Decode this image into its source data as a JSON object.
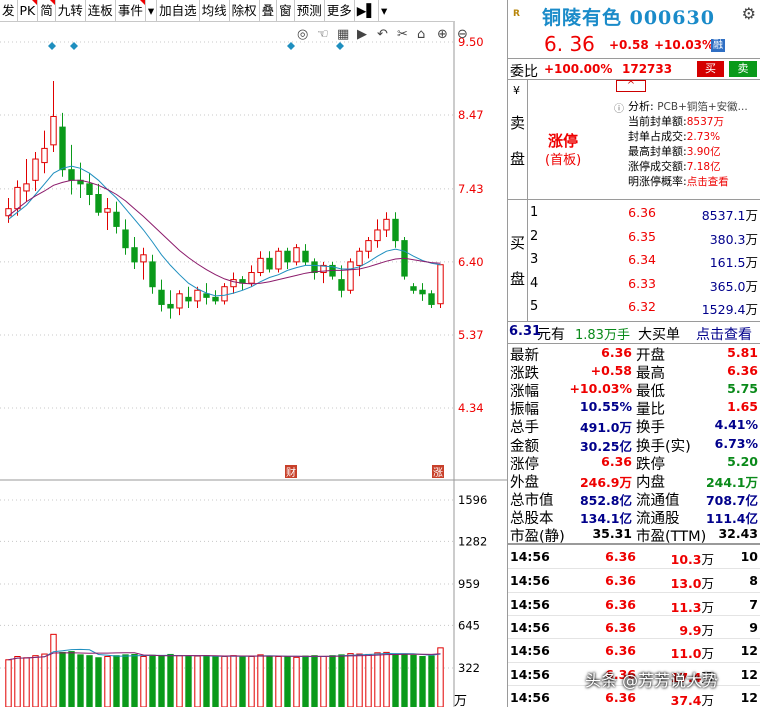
{
  "toolbar": {
    "items": [
      {
        "label": "发",
        "flag": false
      },
      {
        "label": "PK",
        "flag": true
      },
      {
        "label": "简",
        "flag": true
      },
      {
        "label": "九转",
        "flag": false
      },
      {
        "label": "连板",
        "flag": false
      },
      {
        "label": "事件",
        "flag": true
      },
      {
        "label": "▾",
        "flag": false
      },
      {
        "label": "加自选",
        "flag": false
      },
      {
        "label": "均线",
        "flag": false
      },
      {
        "label": "除权",
        "flag": false
      },
      {
        "label": "叠",
        "flag": false
      },
      {
        "label": "窗",
        "flag": false
      },
      {
        "label": "预测",
        "flag": false
      },
      {
        "label": "更多",
        "flag": false
      },
      {
        "label": "▶▌",
        "flag": false
      },
      {
        "label": "▾",
        "flag": false
      }
    ],
    "chart_tools": [
      "◎",
      "☜",
      "▦",
      "▶",
      "↶",
      "✂",
      "⌂",
      "⊕",
      "⊖"
    ]
  },
  "chart_data": {
    "type": "candlestick",
    "price_axis_labels": [
      "9.50",
      "8.47",
      "7.43",
      "6.40",
      "5.37",
      "4.34"
    ],
    "price_ylim": [
      3.4,
      9.5
    ],
    "volume_axis_labels": [
      "1596",
      "1282",
      "959",
      "645",
      "322"
    ],
    "volume_unit": "万",
    "volume_ylim": [
      0,
      1900
    ],
    "event_markers": [
      "财",
      "涨"
    ],
    "colors": {
      "up": "#e00000",
      "down": "#0a9a1a",
      "ma_short": "#1f8fbf",
      "ma_long": "#8b1a6b"
    },
    "candles": [
      {
        "o": 7.05,
        "h": 7.3,
        "l": 6.95,
        "c": 7.15
      },
      {
        "o": 7.15,
        "h": 7.55,
        "l": 7.05,
        "c": 7.45
      },
      {
        "o": 7.4,
        "h": 7.85,
        "l": 7.25,
        "c": 7.5
      },
      {
        "o": 7.55,
        "h": 7.95,
        "l": 7.4,
        "c": 7.85
      },
      {
        "o": 7.8,
        "h": 8.25,
        "l": 7.65,
        "c": 8.0
      },
      {
        "o": 8.05,
        "h": 8.95,
        "l": 7.95,
        "c": 8.45
      },
      {
        "o": 8.3,
        "h": 8.5,
        "l": 7.6,
        "c": 7.7
      },
      {
        "o": 7.7,
        "h": 8.05,
        "l": 7.35,
        "c": 7.55
      },
      {
        "o": 7.55,
        "h": 7.8,
        "l": 7.3,
        "c": 7.5
      },
      {
        "o": 7.5,
        "h": 7.65,
        "l": 7.2,
        "c": 7.35
      },
      {
        "o": 7.35,
        "h": 7.5,
        "l": 7.05,
        "c": 7.1
      },
      {
        "o": 7.1,
        "h": 7.3,
        "l": 6.85,
        "c": 7.15
      },
      {
        "o": 7.1,
        "h": 7.25,
        "l": 6.8,
        "c": 6.9
      },
      {
        "o": 6.85,
        "h": 7.0,
        "l": 6.5,
        "c": 6.6
      },
      {
        "o": 6.6,
        "h": 6.75,
        "l": 6.3,
        "c": 6.4
      },
      {
        "o": 6.4,
        "h": 6.6,
        "l": 6.15,
        "c": 6.5
      },
      {
        "o": 6.4,
        "h": 6.5,
        "l": 5.95,
        "c": 6.05
      },
      {
        "o": 6.0,
        "h": 6.15,
        "l": 5.7,
        "c": 5.8
      },
      {
        "o": 5.8,
        "h": 6.0,
        "l": 5.6,
        "c": 5.75
      },
      {
        "o": 5.75,
        "h": 6.0,
        "l": 5.65,
        "c": 5.95
      },
      {
        "o": 5.9,
        "h": 6.05,
        "l": 5.75,
        "c": 5.85
      },
      {
        "o": 5.85,
        "h": 6.05,
        "l": 5.75,
        "c": 6.0
      },
      {
        "o": 5.95,
        "h": 6.1,
        "l": 5.8,
        "c": 5.9
      },
      {
        "o": 5.9,
        "h": 6.0,
        "l": 5.8,
        "c": 5.85
      },
      {
        "o": 5.85,
        "h": 6.1,
        "l": 5.8,
        "c": 6.05
      },
      {
        "o": 6.05,
        "h": 6.25,
        "l": 5.95,
        "c": 6.15
      },
      {
        "o": 6.15,
        "h": 6.2,
        "l": 6.0,
        "c": 6.1
      },
      {
        "o": 6.1,
        "h": 6.35,
        "l": 6.05,
        "c": 6.25
      },
      {
        "o": 6.25,
        "h": 6.55,
        "l": 6.2,
        "c": 6.45
      },
      {
        "o": 6.45,
        "h": 6.55,
        "l": 6.25,
        "c": 6.3
      },
      {
        "o": 6.3,
        "h": 6.6,
        "l": 6.25,
        "c": 6.55
      },
      {
        "o": 6.55,
        "h": 6.6,
        "l": 6.3,
        "c": 6.4
      },
      {
        "o": 6.4,
        "h": 6.65,
        "l": 6.35,
        "c": 6.6
      },
      {
        "o": 6.55,
        "h": 6.65,
        "l": 6.35,
        "c": 6.4
      },
      {
        "o": 6.4,
        "h": 6.45,
        "l": 6.15,
        "c": 6.25
      },
      {
        "o": 6.25,
        "h": 6.4,
        "l": 6.1,
        "c": 6.35
      },
      {
        "o": 6.35,
        "h": 6.4,
        "l": 6.15,
        "c": 6.2
      },
      {
        "o": 6.15,
        "h": 6.35,
        "l": 5.9,
        "c": 6.0
      },
      {
        "o": 6.0,
        "h": 6.45,
        "l": 5.95,
        "c": 6.4
      },
      {
        "o": 6.35,
        "h": 6.6,
        "l": 6.2,
        "c": 6.55
      },
      {
        "o": 6.55,
        "h": 6.75,
        "l": 6.45,
        "c": 6.7
      },
      {
        "o": 6.7,
        "h": 7.0,
        "l": 6.6,
        "c": 6.85
      },
      {
        "o": 6.85,
        "h": 7.1,
        "l": 6.75,
        "c": 7.0
      },
      {
        "o": 7.0,
        "h": 7.1,
        "l": 6.6,
        "c": 6.7
      },
      {
        "o": 6.7,
        "h": 6.75,
        "l": 6.15,
        "c": 6.2
      },
      {
        "o": 6.05,
        "h": 6.1,
        "l": 5.95,
        "c": 6.0
      },
      {
        "o": 6.0,
        "h": 6.1,
        "l": 5.85,
        "c": 5.95
      },
      {
        "o": 5.95,
        "h": 6.0,
        "l": 5.75,
        "c": 5.8
      },
      {
        "o": 5.81,
        "h": 6.36,
        "l": 5.75,
        "c": 6.36
      }
    ],
    "volumes": [
      200,
      280,
      250,
      300,
      340,
      820,
      380,
      400,
      320,
      300,
      250,
      280,
      300,
      320,
      330,
      280,
      310,
      290,
      330,
      300,
      280,
      290,
      300,
      270,
      280,
      300,
      290,
      280,
      320,
      290,
      280,
      270,
      260,
      290,
      300,
      280,
      300,
      320,
      350,
      340,
      330,
      370,
      380,
      330,
      340,
      310,
      280,
      290,
      491
    ],
    "ma_short": [
      7.0,
      7.1,
      7.2,
      7.35,
      7.5,
      7.65,
      7.72,
      7.75,
      7.72,
      7.65,
      7.55,
      7.42,
      7.3,
      7.15,
      7.0,
      6.85,
      6.68,
      6.5,
      6.35,
      6.22,
      6.1,
      6.02,
      5.96,
      5.92,
      5.93,
      5.96,
      6.0,
      6.05,
      6.12,
      6.18,
      6.22,
      6.28,
      6.32,
      6.35,
      6.35,
      6.34,
      6.33,
      6.3,
      6.3,
      6.33,
      6.4,
      6.48,
      6.55,
      6.58,
      6.55,
      6.48,
      6.42,
      6.38,
      6.36
    ],
    "ma_long": [
      7.05,
      7.15,
      7.25,
      7.33,
      7.4,
      7.48,
      7.52,
      7.55,
      7.55,
      7.52,
      7.48,
      7.42,
      7.35,
      7.26,
      7.15,
      7.04,
      6.92,
      6.8,
      6.68,
      6.56,
      6.46,
      6.37,
      6.29,
      6.22,
      6.16,
      6.12,
      6.1,
      6.09,
      6.1,
      6.12,
      6.15,
      6.18,
      6.21,
      6.24,
      6.26,
      6.27,
      6.28,
      6.28,
      6.29,
      6.3,
      6.33,
      6.37,
      6.41,
      6.44,
      6.45,
      6.43,
      6.41,
      6.39,
      6.38
    ]
  },
  "header": {
    "badge": "R",
    "title": "铜陵有色 000630",
    "price": "6. 36",
    "change": "+0.58",
    "change_pct": "+10.03%",
    "rong_badge": "融"
  },
  "weibi": {
    "label": "委比",
    "ratio": "+100.00%",
    "diff": "172733",
    "buy_label": "买",
    "sell_label": "卖"
  },
  "sell_side": {
    "side_label": [
      "卖",
      "盘"
    ],
    "side_mark": "¥",
    "caret": "^",
    "limit_status": "涨停",
    "limit_sub": "(首板)",
    "analysis_label": "分析:",
    "analysis_text": "PCB+铜箔+安徽...",
    "metrics": [
      {
        "key": "当前封单额:",
        "value": "8537万"
      },
      {
        "key": "封单占成交:",
        "value": "2.73%"
      },
      {
        "key": "最高封单额:",
        "value": "3.90亿"
      },
      {
        "key": "涨停成交额:",
        "value": "7.18亿"
      },
      {
        "key": "明涨停概率:",
        "value": "点击查看"
      }
    ]
  },
  "buy_side": {
    "side_label": [
      "买",
      "盘"
    ],
    "levels": [
      {
        "n": "1",
        "price": "6.36",
        "qty": "8537.1",
        "unit": "万"
      },
      {
        "n": "2",
        "price": "6.35",
        "qty": "380.3",
        "unit": "万"
      },
      {
        "n": "3",
        "price": "6.34",
        "qty": "161.5",
        "unit": "万"
      },
      {
        "n": "4",
        "price": "6.33",
        "qty": "365.0",
        "unit": "万"
      },
      {
        "n": "5",
        "price": "6.32",
        "qty": "1529.4",
        "unit": "万"
      }
    ]
  },
  "deal": {
    "price": "6.31",
    "price_unit": "元有",
    "volume": "1.83万手",
    "type": "大买单",
    "link": "点击查看"
  },
  "quote": {
    "rows": [
      {
        "l1": "最新",
        "v1": "6.36",
        "c1": "red",
        "l2": "开盘",
        "v2": "5.81",
        "c2": "red"
      },
      {
        "l1": "涨跌",
        "v1": "+0.58",
        "c1": "red",
        "l2": "最高",
        "v2": "6.36",
        "c2": "red"
      },
      {
        "l1": "涨幅",
        "v1": "+10.03%",
        "c1": "red",
        "l2": "最低",
        "v2": "5.75",
        "c2": "green"
      },
      {
        "l1": "振幅",
        "v1": "10.55%",
        "c1": "navy",
        "l2": "量比",
        "v2": "1.65",
        "c2": "red"
      },
      {
        "l1": "总手",
        "v1": "491.0万",
        "c1": "navy",
        "l2": "换手",
        "v2": "4.41%",
        "c2": "navy"
      },
      {
        "l1": "金额",
        "v1": "30.25亿",
        "c1": "navy",
        "l2": "换手(实)",
        "v2": "6.73%",
        "c2": "navy"
      },
      {
        "l1": "涨停",
        "v1": "6.36",
        "c1": "red",
        "l2": "跌停",
        "v2": "5.20",
        "c2": "green"
      },
      {
        "l1": "外盘",
        "v1": "246.9万",
        "c1": "red",
        "l2": "内盘",
        "v2": "244.1万",
        "c2": "green"
      },
      {
        "l1": "总市值",
        "v1": "852.8亿",
        "c1": "navy",
        "l2": "流通值",
        "v2": "708.7亿",
        "c2": "navy"
      },
      {
        "l1": "总股本",
        "v1": "134.1亿",
        "c1": "navy",
        "l2": "流通股",
        "v2": "111.4亿",
        "c2": "navy"
      },
      {
        "l1": "市盈(静)",
        "v1": "35.31",
        "c1": "blk",
        "l2": "市盈(TTM)",
        "v2": "32.43",
        "c2": "blk"
      }
    ]
  },
  "ticks": [
    {
      "time": "14:56",
      "price": "6.36",
      "vol": "10.3",
      "unit": "万",
      "count": "10"
    },
    {
      "time": "14:56",
      "price": "6.36",
      "vol": "13.0",
      "unit": "万",
      "count": "8"
    },
    {
      "time": "14:56",
      "price": "6.36",
      "vol": "11.3",
      "unit": "万",
      "count": "7"
    },
    {
      "time": "14:56",
      "price": "6.36",
      "vol": "9.9",
      "unit": "万",
      "count": "9"
    },
    {
      "time": "14:56",
      "price": "6.36",
      "vol": "11.0",
      "unit": "万",
      "count": "12"
    },
    {
      "time": "14:56",
      "price": "6.36",
      "vol": "17.4",
      "unit": "万",
      "count": "12"
    },
    {
      "time": "14:56",
      "price": "6.36",
      "vol": "37.4",
      "unit": "万",
      "count": "12"
    }
  ],
  "watermark": "头条 @芳芳说大势"
}
